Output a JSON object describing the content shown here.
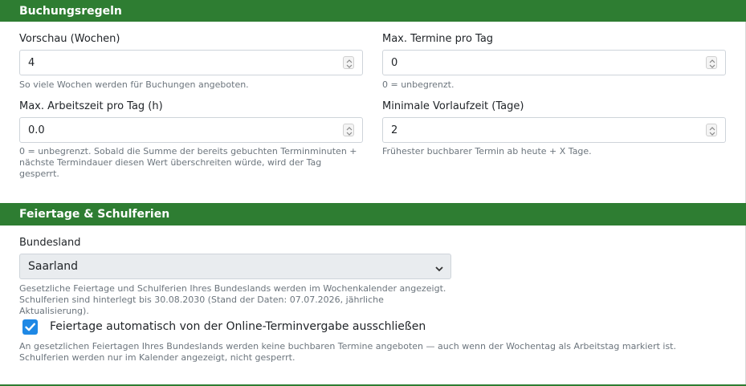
{
  "booking_rules": {
    "header": "Buchungsregeln",
    "preview_weeks": {
      "label": "Vorschau (Wochen)",
      "value": "4",
      "hint": "So viele Wochen werden für Buchungen angeboten."
    },
    "max_appointments": {
      "label": "Max. Termine pro Tag",
      "value": "0",
      "hint": "0 = unbegrenzt."
    },
    "max_work_time": {
      "label": "Max. Arbeitszeit pro Tag (h)",
      "value": "0.0",
      "hint_lines": [
        "0 = unbegrenzt. Sobald die Summe der bereits gebuchten Terminminuten +",
        "nächste Termindauer diesen Wert überschreiten würde, wird der Tag",
        "gesperrt."
      ]
    },
    "min_lead_time": {
      "label": "Minimale Vorlaufzeit (Tage)",
      "value": "2",
      "hint": "Frühester buchbarer Termin ab heute + X Tage."
    }
  },
  "holidays": {
    "header": "Feiertage & Schulferien",
    "state": {
      "label": "Bundesland",
      "selected": "Saarland",
      "hint_lines": [
        "Gesetzliche Feiertage und Schulferien Ihres Bundeslands werden im Wochenkalender angezeigt.",
        "Schulferien sind hinterlegt bis 30.08.2030 (Stand der Daten: 07.07.2026, jährliche",
        "Aktualisierung)."
      ]
    },
    "exclude_holidays": {
      "checked": true,
      "label": "Feiertage automatisch von der Online-Terminvergabe ausschließen",
      "hint_lines": [
        "An gesetzlichen Feiertagen Ihres Bundeslands werden keine buchbaren Termine angeboten — auch wenn der Wochentag als Arbeitstag markiert ist.",
        "Schulferien werden nur im Kalender angezeigt, nicht gesperrt."
      ]
    }
  },
  "colors": {
    "header_green": "#2e7d32",
    "checkbox_blue": "#1e88e5"
  },
  "icons": {
    "spinner": "spinner-arrows-icon",
    "select_chevron": "chevron-down-icon",
    "checkmark": "checkmark-icon"
  }
}
